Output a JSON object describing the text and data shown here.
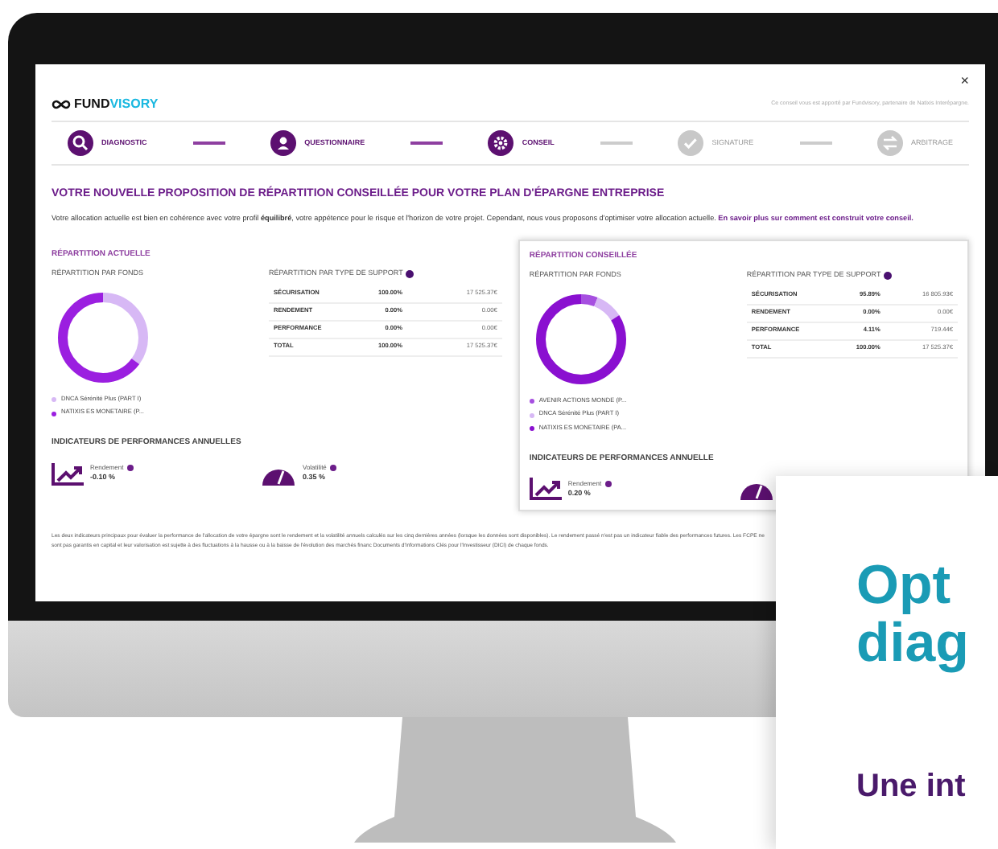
{
  "header": {
    "close": "×",
    "logo": {
      "part_1": "FUND",
      "part_2": "VISORY"
    },
    "note": "Ce conseil vous est apporté par Fundvisory, partenaire de Natixis Interépargne."
  },
  "steps": [
    {
      "label": "DIAGNOSTIC",
      "kind": "search",
      "done": true
    },
    {
      "label": "QUESTIONNAIRE",
      "kind": "person",
      "done": true
    },
    {
      "label": "CONSEIL",
      "kind": "gear",
      "done": true
    },
    {
      "label": "SIGNATURE",
      "kind": "check",
      "done": false
    },
    {
      "label": "ARBITRAGE",
      "kind": "swap",
      "done": false
    }
  ],
  "title": "VOTRE NOUVELLE PROPOSITION DE RÉPARTITION CONSEILLÉE POUR VOTRE PLAN D'ÉPARGNE ENTREPRISE",
  "intro": "Votre allocation actuelle est bien en cohérence avec votre profil **équilibré**, votre appétence pour le risque et l'horizon de votre projet. Cependant, nous vous proposons d'optimiser votre allocation actuelle.",
  "intro_link": "En savoir plus sur comment est construit votre conseil.",
  "panels": [
    {
      "title": "RÉPARTITION ACTUELLE",
      "boxed": false,
      "funds_heading": "RÉPARTITION PAR FONDS",
      "support_heading": "RÉPARTITION PAR TYPE DE SUPPORT",
      "legend": [
        {
          "label": "DNCA Sérénité Plus (PART I)",
          "color": "#d7b8f5"
        },
        {
          "label": "NATIXIS ES MONETAIRE (P...",
          "color": "#9b1fe0"
        }
      ],
      "rows": [
        {
          "name": "SÉCURISATION",
          "pct": "100.00%",
          "amount": "17 525.37€"
        },
        {
          "name": "RENDEMENT",
          "pct": "0.00%",
          "amount": "0.00€"
        },
        {
          "name": "PERFORMANCE",
          "pct": "0.00%",
          "amount": "0.00€"
        },
        {
          "name": "TOTAL",
          "pct": "100.00%",
          "amount": "17 525.37€"
        }
      ],
      "indicators_heading": "INDICATEURS DE PERFORMANCES ANNUELLES",
      "indicators": [
        {
          "kind": "trend",
          "label": "Rendement",
          "value": "-0.10 %"
        },
        {
          "kind": "gauge",
          "label": "Volatilité",
          "value": "0.35 %"
        }
      ]
    },
    {
      "title": "RÉPARTITION CONSEILLÉE",
      "boxed": true,
      "funds_heading": "RÉPARTITION PAR FONDS",
      "support_heading": "RÉPARTITION PAR TYPE DE SUPPORT",
      "legend": [
        {
          "label": "AVENIR ACTIONS MONDE (P...",
          "color": "#a64fe0"
        },
        {
          "label": "DNCA Sérénité Plus (PART I)",
          "color": "#d7b8f5"
        },
        {
          "label": "NATIXIS ES MONETAIRE (PA...",
          "color": "#8a10d0"
        }
      ],
      "rows": [
        {
          "name": "SÉCURISATION",
          "pct": "95.89%",
          "amount": "16 805.93€"
        },
        {
          "name": "RENDEMENT",
          "pct": "0.00%",
          "amount": "0.00€"
        },
        {
          "name": "PERFORMANCE",
          "pct": "4.11%",
          "amount": "719.44€"
        },
        {
          "name": "TOTAL",
          "pct": "100.00%",
          "amount": "17 525.37€"
        }
      ],
      "indicators_heading": "INDICATEURS DE PERFORMANCES ANNUELLE",
      "indicators": [
        {
          "kind": "trend",
          "label": "Rendement",
          "value": "0.20 %"
        },
        {
          "kind": "gauge"
        }
      ]
    }
  ],
  "footnote": "Les deux indicateurs principaux pour évaluer la performance de l'allocation de votre épargne sont le rendement et la volatilité annuels calculés sur les cinq dernières années (lorsque les données sont disponibles). Le rendement passé n'est pas un indicateur fiable des performances futures. Les FCPE ne sont pas garantis en capital et leur valorisation est sujette à des fluctuations à la hausse ou à la baisse de l'évolution des marchés financ Documents d'Informations Clés pour l'Investisseur (DICI) de chaque fonds.",
  "slide_card": {
    "heading_line_1": "Opt",
    "heading_line_2": "diag",
    "subheading": "Une int"
  }
}
